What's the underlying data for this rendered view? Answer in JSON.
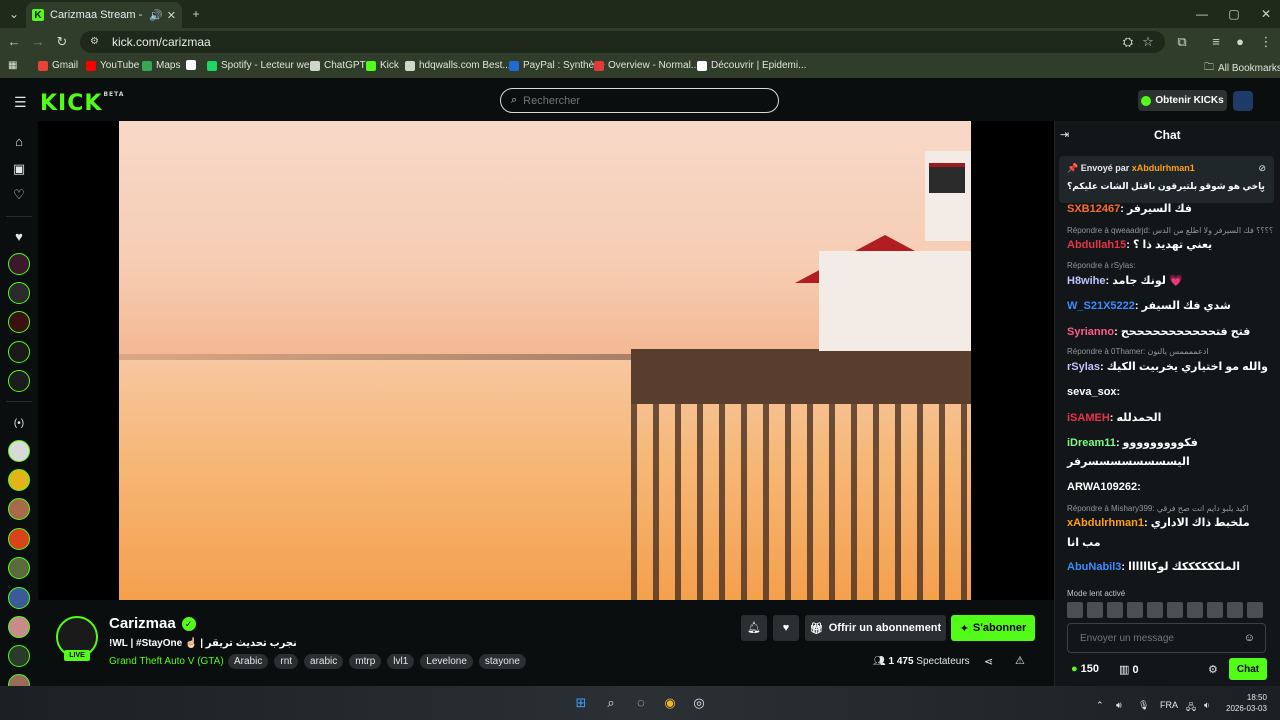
{
  "browser": {
    "tab_title": "Carizmaa Stream - Watch L",
    "tab_favicon": "K",
    "url": "kick.com/carizmaa",
    "bookmarks": [
      {
        "label": "Gmail",
        "color": "#ea4335"
      },
      {
        "label": "YouTube",
        "color": "#ff0000"
      },
      {
        "label": "Maps",
        "color": "#34a853"
      },
      {
        "label": "",
        "color": "#ffffff"
      },
      {
        "label": "Spotify - Lecteur we...",
        "color": "#1ed760"
      },
      {
        "label": "ChatGPT",
        "color": "#cfd6cc"
      },
      {
        "label": "Kick",
        "color": "#53fc18"
      },
      {
        "label": "hdqwalls.com Best...",
        "color": "#cfd6cc"
      },
      {
        "label": "PayPal : Synthèse",
        "color": "#1e6bd6"
      },
      {
        "label": "Overview - Normal...",
        "color": "#e03a3a"
      },
      {
        "label": "Découvrir | Epidemi...",
        "color": "#ffffff"
      }
    ],
    "all_bookmarks": "All Bookmarks"
  },
  "header": {
    "logo": "KICK",
    "logo_beta": "BETA",
    "search_placeholder": "Rechercher",
    "kicks_button": "Obtenir KICKs"
  },
  "stream": {
    "channel_name": "Carizmaa",
    "live_badge": "LIVE",
    "title": "!WL | #StayOne ☝🏻 | نجرب تحديث تريقر",
    "category": "Grand Theft Auto V (GTA)",
    "tags": [
      "Arabic",
      "rnt",
      "arabic",
      "mtrp",
      "lvl1",
      "Levelone",
      "stayone"
    ],
    "subscribe_button": "Offrir un abonnement",
    "follow_button": "S'abonner",
    "viewer_count": "1 475",
    "viewer_label": "Spectateurs"
  },
  "chat": {
    "title": "Chat",
    "pinned_by_label": "Envoyé par",
    "pinned_user": "xAbdulrhman1",
    "pinned_text": "ياخي هو شوقو بلتيرقون باقتل الشات عليكم؟",
    "messages": [
      {
        "user": "SXB12467",
        "color": "#ff6b2a",
        "text": "فك السيرفر"
      },
      {
        "reply": "Répondre à qweaadrjd: ؟؟؟؟ فك السيرفر ولا اطلع من الدس"
      },
      {
        "user": "Abdullah15",
        "color": "#e8334a",
        "text": "يعني تهديد ذا ؟"
      },
      {
        "reply": "Répondre à rSylas:"
      },
      {
        "user": "H8wihe",
        "color": "#bfc5ff",
        "text": "لونك جامد 💗"
      },
      {
        "user": "W_S21X5222",
        "color": "#3d8bff",
        "text": "شدي فك السيفر"
      },
      {
        "user": "Syrianno",
        "color": "#ff5a8a",
        "text": "فتح فتحححححححححححح"
      },
      {
        "reply": "Répondre à 0Thamer: ادعممممس يالنون"
      },
      {
        "user": "rSylas",
        "color": "#bfc5ff",
        "text": "والله مو اختياري يخربيت الكيك"
      },
      {
        "user": "seva_sox",
        "color": "#ffffff",
        "text": ""
      },
      {
        "user": "iSAMEH",
        "color": "#e8334a",
        "text": "الحمدلله"
      },
      {
        "user": "iDream11",
        "color": "#7dfc8a",
        "text": "فكووووووووو"
      },
      {
        "text": "اليسسسسسسسسرفر"
      },
      {
        "user": "ARWA109262",
        "color": "#ffffff",
        "text": ""
      },
      {
        "reply": "Répondre à Mishary399: اكيد يلبو دايم انت صح فرقي"
      },
      {
        "user": "xAbdulrhman1",
        "color": "#ff9f1a",
        "text": "ملخبط ذاك الاداري"
      },
      {
        "text": "مب انا"
      },
      {
        "user": "AbuNabil3",
        "color": "#3d8bff",
        "text": "الملككككككك لوكاااااا"
      }
    ],
    "slow_mode": "Mode lent activé",
    "input_placeholder": "Envoyer un message",
    "points": "150",
    "gifts": "0",
    "send_button": "Chat"
  },
  "taskbar": {
    "lang": "FRA",
    "time": "18:50",
    "date": "2026-03-03"
  }
}
